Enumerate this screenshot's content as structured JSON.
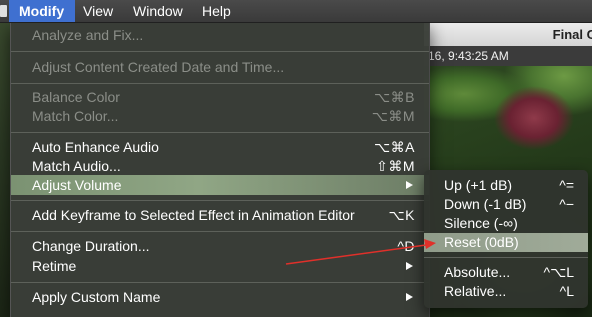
{
  "menubar": {
    "items": [
      {
        "label": "Modify"
      },
      {
        "label": "View"
      },
      {
        "label": "Window"
      },
      {
        "label": "Help"
      }
    ]
  },
  "background": {
    "window_title": "Final C",
    "info_text": "16, 9:43:25 AM"
  },
  "main_menu": {
    "items": [
      {
        "label": "Analyze and Fix...",
        "shortcut": "",
        "enabled": false
      },
      {
        "label": "Adjust Content Created Date and Time...",
        "shortcut": "",
        "enabled": false
      },
      {
        "label": "Balance Color",
        "shortcut": "⌥⌘B",
        "enabled": false
      },
      {
        "label": "Match Color...",
        "shortcut": "⌥⌘M",
        "enabled": false
      },
      {
        "label": "Auto Enhance Audio",
        "shortcut": "⌥⌘A",
        "enabled": true
      },
      {
        "label": "Match Audio...",
        "shortcut": "⇧⌘M",
        "enabled": true
      },
      {
        "label": "Adjust Volume",
        "shortcut": "",
        "enabled": true,
        "submenu": true,
        "highlighted": true
      },
      {
        "label": "Add Keyframe to Selected Effect in Animation Editor",
        "shortcut": "⌥K",
        "enabled": true
      },
      {
        "label": "Change Duration...",
        "shortcut": "^D",
        "enabled": true
      },
      {
        "label": "Retime",
        "shortcut": "",
        "enabled": true,
        "submenu": true
      },
      {
        "label": "Apply Custom Name",
        "shortcut": "",
        "enabled": true,
        "submenu": true
      }
    ]
  },
  "sub_menu": {
    "items": [
      {
        "label": "Up (+1 dB)",
        "shortcut": "^="
      },
      {
        "label": "Down (-1 dB)",
        "shortcut": "^−"
      },
      {
        "label": "Silence (-∞)",
        "shortcut": ""
      },
      {
        "label": "Reset (0dB)",
        "shortcut": "",
        "highlighted": true
      },
      {
        "label": "Absolute...",
        "shortcut": "^⌥L"
      },
      {
        "label": "Relative...",
        "shortcut": "^L"
      }
    ]
  },
  "colors": {
    "menu_highlight": "#3f70d0",
    "annotation_arrow": "#e0302a"
  }
}
